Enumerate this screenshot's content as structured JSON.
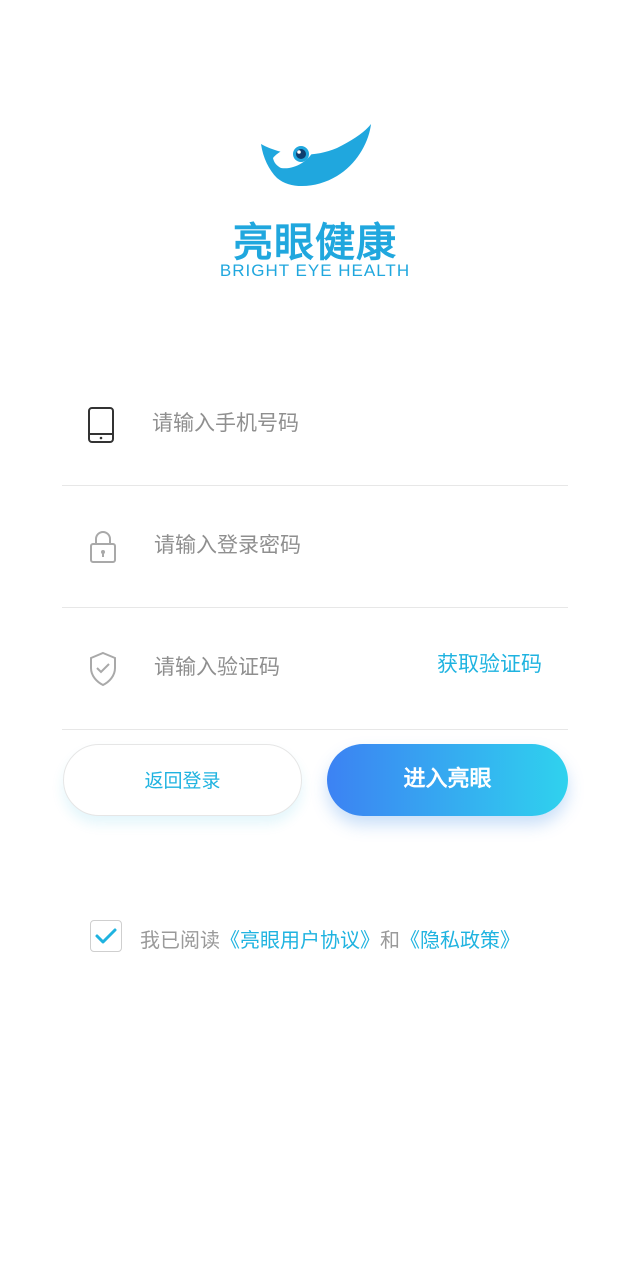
{
  "brand": {
    "name_cn": "亮眼健康",
    "name_en": "BRIGHT EYE HEALTH",
    "color": "#20a7de"
  },
  "form": {
    "phone": {
      "placeholder": "请输入手机号码",
      "value": "",
      "icon": "phone-icon"
    },
    "password": {
      "placeholder": "请输入登录密码",
      "value": "",
      "icon": "lock-icon"
    },
    "code": {
      "placeholder": "请输入验证码",
      "value": "",
      "icon": "shield-check-icon",
      "get_code_label": "获取验证码"
    }
  },
  "buttons": {
    "back_label": "返回登录",
    "enter_label": "进入亮眼"
  },
  "agreement": {
    "checked": true,
    "prefix": "我已阅读",
    "user_agreement": "《亮眼用户协议》",
    "conjunction": "和",
    "privacy_policy": "《隐私政策》"
  },
  "colors": {
    "accent": "#1fb3e0",
    "gradient_start": "#3c82f3",
    "gradient_end": "#2fd2ee",
    "divider": "#e7e7e7",
    "placeholder": "#8f8f8f"
  }
}
